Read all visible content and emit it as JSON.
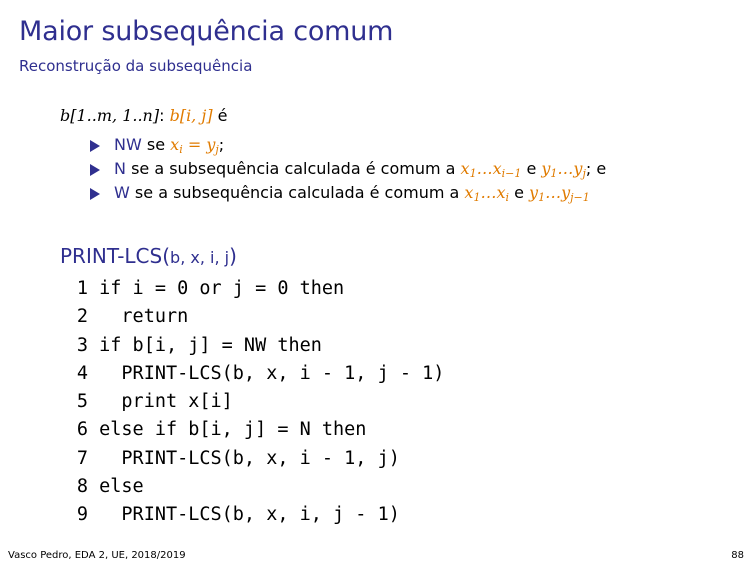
{
  "slide": {
    "title": "Maior subsequência comum",
    "subtitle": "Reconstrução da subsequência"
  },
  "definition": {
    "lead_b": "b",
    "lead_range": "[1..m, 1..n]",
    "lead_colon": ":",
    "lead_entry": "b[i, j]",
    "lead_verb": "é"
  },
  "bullets": [
    {
      "label": "NW",
      "text_before": "se",
      "math": "x",
      "math_sub": "i",
      "math_eq": " = ",
      "math2": "y",
      "math2_sub": "j",
      "text_after": ";"
    },
    {
      "label": "N",
      "text": "se a subsequência calculada é comum a",
      "seq1": "x",
      "seq1_a": "1",
      "seq1_dots": "…x",
      "seq1_b": "i−1",
      "conj": "e",
      "seq2": "y",
      "seq2_a": "1",
      "seq2_dots": "…y",
      "seq2_b": "j",
      "tail": "; e"
    },
    {
      "label": "W",
      "text": "se a subsequência calculada é comum a",
      "seq1": "x",
      "seq1_a": "1",
      "seq1_dots": "…x",
      "seq1_b": "i",
      "conj": "e",
      "seq2": "y",
      "seq2_a": "1",
      "seq2_dots": "…y",
      "seq2_b": "j−1"
    }
  ],
  "procedure": {
    "name": "PRINT-LCS(",
    "args": "b, x, i, j",
    "close": ")",
    "lines": [
      {
        "num": "1",
        "code": " if i = 0 or j = 0 then"
      },
      {
        "num": "2",
        "code": "   return"
      },
      {
        "num": "3",
        "code": " if b[i, j] = NW then"
      },
      {
        "num": "4",
        "code": "   PRINT-LCS(b, x, i - 1, j - 1)"
      },
      {
        "num": "5",
        "code": "   print x[i]"
      },
      {
        "num": "6",
        "code": " else if b[i, j] = N then"
      },
      {
        "num": "7",
        "code": "   PRINT-LCS(b, x, i - 1, j)"
      },
      {
        "num": "8",
        "code": " else"
      },
      {
        "num": "9",
        "code": "   PRINT-LCS(b, x, i, j - 1)"
      }
    ]
  },
  "footer": {
    "left": "Vasco Pedro, EDA 2, UE, 2018/2019",
    "page": "88"
  },
  "colors": {
    "title": "#2f2f8f",
    "highlight": "#e07b00"
  },
  "icons": {
    "bullet": "triangle-bullet-icon"
  }
}
